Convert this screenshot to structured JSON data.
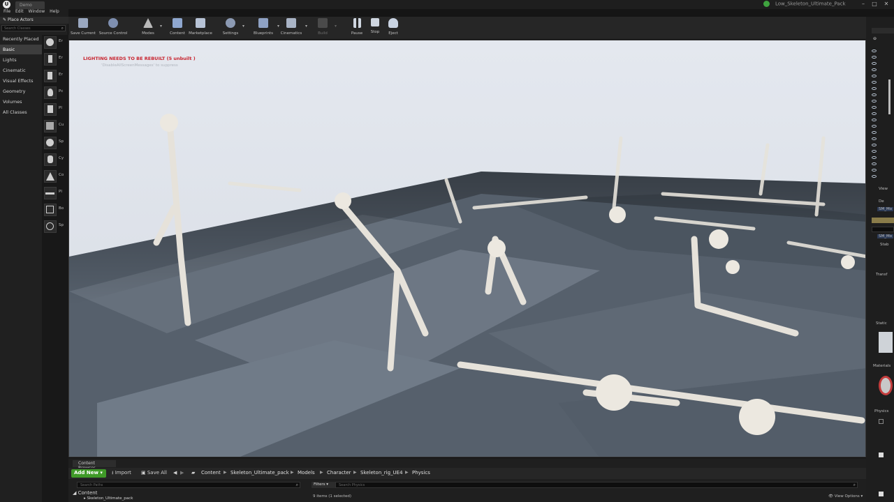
{
  "app": {
    "doc_tab": "Demo",
    "logo": "U",
    "project_name": "Low_Skeleton_Ultimate_Pack"
  },
  "menu": [
    "File",
    "Edit",
    "Window",
    "Help"
  ],
  "place_actors": {
    "title": "Place Actors",
    "search_placeholder": "Search Classes",
    "categories": [
      "Recently Placed",
      "Basic",
      "Lights",
      "Cinematic",
      "Visual Effects",
      "Geometry",
      "Volumes",
      "All Classes"
    ],
    "active_category": "Basic",
    "items": [
      "Er",
      "Er",
      "Er",
      "Pc",
      "Pl",
      "Cu",
      "Sp",
      "Cy",
      "Co",
      "Pl",
      "Bo",
      "Sp"
    ]
  },
  "toolbar": {
    "buttons": [
      "Save Current",
      "Source Control",
      "Modes",
      "Content",
      "Marketplace",
      "Settings",
      "Blueprints",
      "Cinematics",
      "Build",
      "Pause",
      "Stop",
      "Eject"
    ]
  },
  "viewport": {
    "lighting_warning": "LIGHTING NEEDS TO BE REBUILT (5 unbuilt )",
    "suppress_note": "'DisableAllScreenMessages' to suppress"
  },
  "details": {
    "view_label": "View",
    "de_label": "De",
    "mesh_label": "SM_Mo",
    "mesh_label_2": "SM_Mo",
    "stab_label": "Stab",
    "transform_label": "Transf",
    "static_label": "Static",
    "materials_label": "Materials",
    "physics_label": "Physics"
  },
  "content_browser": {
    "tab_label": "Content Browser",
    "add_new": "Add New",
    "import": "Import",
    "save_all": "Save All",
    "breadcrumbs": [
      "Content",
      "Skeleton_Ultimate_pack",
      "Models",
      "Character",
      "Skeleton_rig_UE4",
      "Physics"
    ],
    "paths_placeholder": "Search Paths",
    "filters": "Filters",
    "asset_placeholder": "Search Physics",
    "tree_root": "Content",
    "tree_child": "Skeleton_Ultimate_pack",
    "items_status": "9 items (1 selected)",
    "view_options": "View Options"
  }
}
